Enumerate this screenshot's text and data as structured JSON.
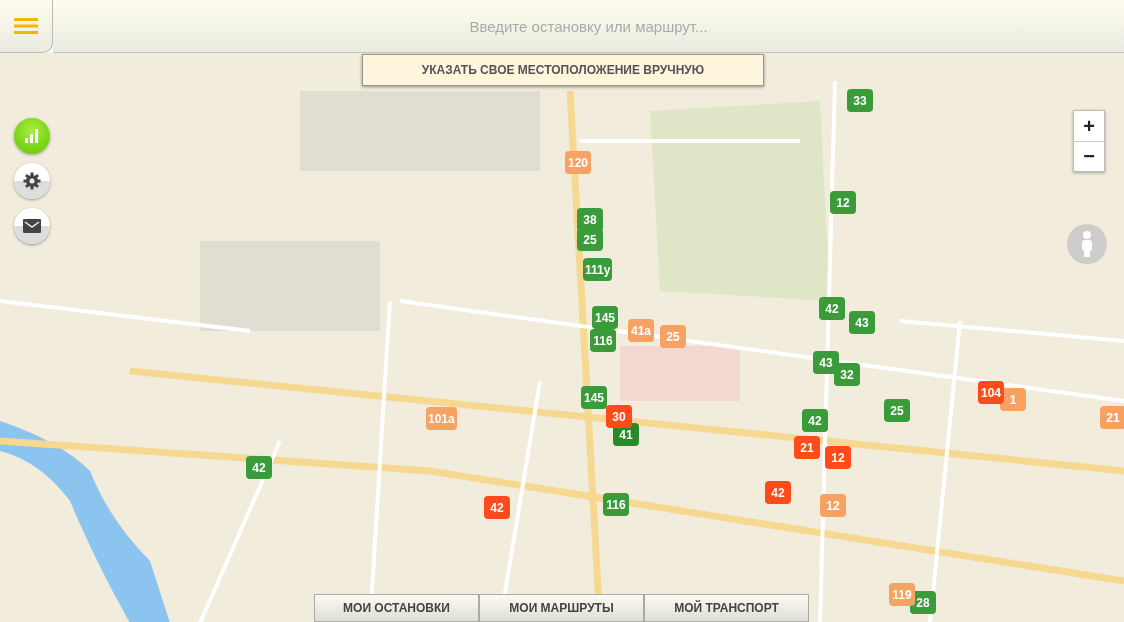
{
  "search": {
    "placeholder": "Введите остановку или маршрут..."
  },
  "locate_button": "УКАЗАТЬ СВОЕ МЕСТОПОЛОЖЕНИЕ ВРУЧНУЮ",
  "zoom": {
    "in": "+",
    "out": "−"
  },
  "vehicles": [
    {
      "route": "33",
      "color": "#3a9b3a"
    },
    {
      "route": "120",
      "color": "#f6a263"
    },
    {
      "route": "38",
      "color": "#3a9b3a"
    },
    {
      "route": "25",
      "color": "#3a9b3a"
    },
    {
      "route": "111у",
      "color": "#3a9b3a"
    },
    {
      "route": "12",
      "color": "#3a9b3a"
    },
    {
      "route": "42",
      "color": "#3a9b3a"
    },
    {
      "route": "43",
      "color": "#3a9b3a"
    },
    {
      "route": "145",
      "color": "#3a9b3a"
    },
    {
      "route": "41а",
      "color": "#f6a263"
    },
    {
      "route": "25",
      "color": "#f6a263"
    },
    {
      "route": "116",
      "color": "#3a9b3a"
    },
    {
      "route": "43",
      "color": "#3a9b3a"
    },
    {
      "route": "32",
      "color": "#3a9b3a"
    },
    {
      "route": "1",
      "color": "#f6a263"
    },
    {
      "route": "104",
      "color": "#ff4a1c"
    },
    {
      "route": "25",
      "color": "#3a9b3a"
    },
    {
      "route": "21",
      "color": "#f6a263"
    },
    {
      "route": "145",
      "color": "#3a9b3a"
    },
    {
      "route": "41",
      "color": "#2a8a2a"
    },
    {
      "route": "30",
      "color": "#ff4a1c"
    },
    {
      "route": "42",
      "color": "#3a9b3a"
    },
    {
      "route": "21",
      "color": "#ff4a1c"
    },
    {
      "route": "12",
      "color": "#ff4a1c"
    },
    {
      "route": "101а",
      "color": "#f6a263"
    },
    {
      "route": "42",
      "color": "#3a9b3a"
    },
    {
      "route": "42",
      "color": "#ff4a1c"
    },
    {
      "route": "116",
      "color": "#3a9b3a"
    },
    {
      "route": "42",
      "color": "#ff4a1c"
    },
    {
      "route": "12",
      "color": "#f6a263"
    },
    {
      "route": "28",
      "color": "#3a9b3a"
    },
    {
      "route": "119",
      "color": "#f6a263"
    }
  ],
  "bottom_tabs": [
    {
      "label": "МОИ ОСТАНОВКИ"
    },
    {
      "label": "МОИ МАРШРУТЫ"
    },
    {
      "label": "МОЙ ТРАНСПОРТ"
    }
  ]
}
